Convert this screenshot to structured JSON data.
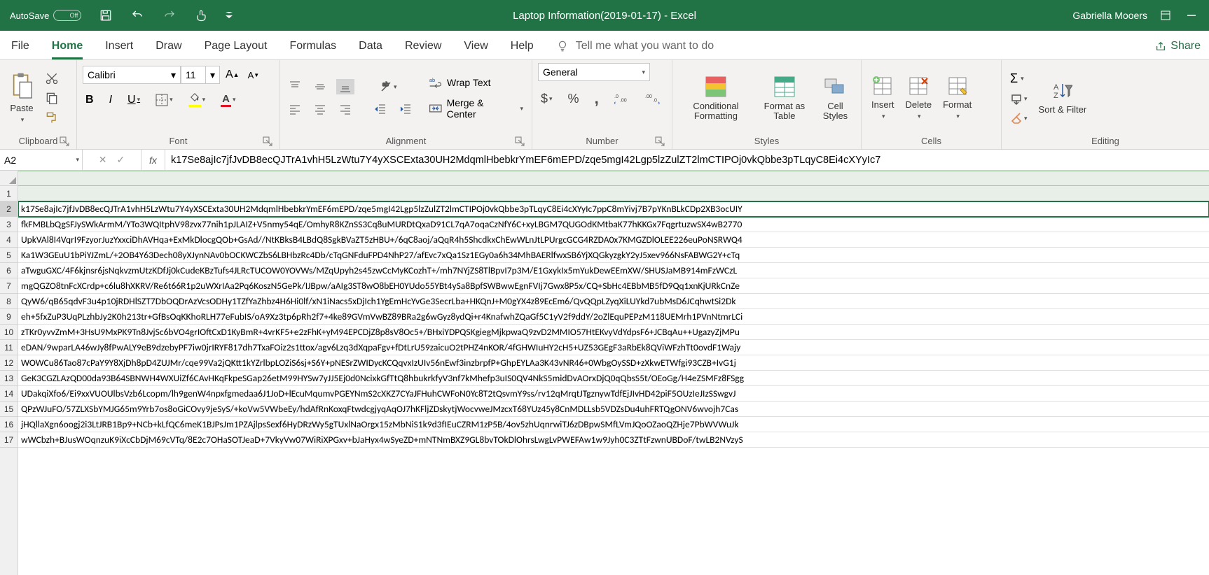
{
  "titlebar": {
    "autosave_label": "AutoSave",
    "autosave_state": "Off",
    "title": "Laptop Information(2019-01-17)  -  Excel",
    "user_name": "Gabriella Mooers"
  },
  "tabs": {
    "file": "File",
    "home": "Home",
    "insert": "Insert",
    "draw": "Draw",
    "page_layout": "Page Layout",
    "formulas": "Formulas",
    "data": "Data",
    "review": "Review",
    "view": "View",
    "help": "Help",
    "tell_me": "Tell me what you want to do",
    "share": "Share"
  },
  "ribbon": {
    "clipboard": {
      "label": "Clipboard",
      "paste": "Paste"
    },
    "font": {
      "label": "Font",
      "name": "Calibri",
      "size": "11",
      "bold": "B",
      "italic": "I",
      "underline": "U"
    },
    "alignment": {
      "label": "Alignment",
      "wrap": "Wrap Text",
      "merge": "Merge & Center"
    },
    "number": {
      "label": "Number",
      "format": "General"
    },
    "styles": {
      "label": "Styles",
      "conditional": "Conditional Formatting",
      "table": "Format as Table",
      "cell": "Cell Styles"
    },
    "cells": {
      "label": "Cells",
      "insert": "Insert",
      "delete": "Delete",
      "format": "Format"
    },
    "editing": {
      "label": "Editing",
      "sort": "Sort & Filter"
    }
  },
  "namebox": "A2",
  "fx_label": "fx",
  "formula_bar": "k17Se8ajIc7jfJvDB8ecQJTrA1vhH5LzWtu7Y4yXSCExta30UH2MdqmlHbebkrYmEF6mEPD/zqe5mgI42Lgp5lzZulZT2lmCTIPOj0vkQbbe3pTLqyC8Ei4cXYyIc7",
  "rows": [
    "",
    "k17Se8ajIc7jfJvDB8ecQJTrA1vhH5LzWtu7Y4yXSCExta30UH2MdqmlHbebkrYmEF6mEPD/zqe5mgI42Lgp5lzZulZT2lmCTIPOj0vkQbbe3pTLqyC8Ei4cXYyIc7ppC8mYivj7B7pYKnBLkCDp2XB3ocUIY",
    "fkFMBLbQgSFJySWkArmM/YTo3WQItphV98zvx77nih1pJLAIZ+V5nmy54qE/OmhyR8KZnSS3Cq8uMURDtQxaD91CL7qA7oqaCzNfY6C+xyLBGM7QUGOdKMtbaK77hKKGx7FqgrtuzwSX4wB2770",
    "UpkVAl8I4VqrI9FzyorJuzYxxciDhAVHqa+ExMkDlocgQOb+GsAd//NtKBksB4LBdQ8SgkBVaZT5zHBU+/6qC8aoj/aQqR4h5ShcdkxChEwWLnJtLPUrgcGCG4RZDA0x7KMGZDlOLEE226euPoNSRWQ4",
    "Ka1W3GEuU1bPiYJZmL/+2OB4Y63Dech08yXJynNAv0bOCKWCZbS6LBHbzRc4Db/cTqGNFduFPD4NhP27/afEvc7xQa1Sz1EGy0a6h34MhBAERlfwxSB6YjXQGkyzgkY2yJ5xev966NsFABWG2Y+cTq",
    "aTwguGXC/4F6kjnsr6jsNqkvzmUtzKDfJj0kCudeKBzTufs4JLRcTUCOW0YOVWs/MZqUpyh2s45zwCcMyKCozhT+/mh7NYjZS8TlBpvI7p3M/E1GxykIx5mYukDewEEmXW/SHUSJaMB914mFzWCzL",
    "mgQGZO8tnFcXCrdp+c6lu8hXKRV/Re6t66R1p2uWXrIAa2Pq6KoszN5GePk/IJBpw/aAIg3ST8wO8bEH0YUdo55YBt4ySa8BpfSWBwwEgnFVIj7Gwx8P5x/CQ+SbHc4EBbMB5fD9Qq1xnKjURkCnZe",
    "QyW6/qB65qdvF3u4p10jRDHlSZT7DbOQDrAzVcsODHy1TZfYaZhbz4H6Hi0lf/xN1iNacs5xDjIch1YgEmHcYvGe3SecrLba+HKQnJ+M0gYX4z89EcEm6/QvQQpLZyqXiLUYkd7ubMsD6JCqhwtSi2Dk",
    "eh+5fxZuP3UqPLzhbJy2K0h213tr+GfBsOqKKhoRLH77eFubIS/oA9Xz3tp6pRh2f7+4ke89GVmVwBZ89BRa2g6wGyz8ydQi+r4KnafwhZQaGf5C1yV2f9ddY/2oZlEquPEPzM118UEMrh1PVnNtmrLCi",
    "zTKr0yvvZmM+3HsU9MxPK9Tn8JvjSc6bVO4grIOftCxD1KyBmR+4vrKF5+e2zFhK+yM94EPCDjZ8p8sV8Oc5+/BHxiYDPQSKgiegMjkpwaQ9zvD2MMIO57HtEKvyVdYdpsF6+JCBqAu++UgazyZjMPu",
    "eDAN/9wparLA46wJy8fPwALY9eB9dzebyPF7iw0jrIRYF817dh7TxaFOiz2s1ttox/agv6Lzq3dXqpaFgv+fDtLrU59zaicuO2tPHZ4nKOR/4fGHWIuHY2cH5+UZ53GEgF3aRbEk8QViWFzhTt0ovdF1Wajy",
    "WOWCu86Tao87cPaY9Y8XjDh8pD4ZUJMr/cqe99Va2jQKtt1kYZrlbpLOZiS6sj+S6Y+pNESrZWIDycKCQqvxIzUIv56nEwf3inzbrpfP+GhpEYLAa3K43vNR46+0WbgOySSD+zXkwETWfgi93CZB+IvG1j",
    "GeK3CGZLAzQD00da93B64SBNWH4WXUiZf6CAvHKqFkpeSGap26etM99HYSw7yJJ5Ej0d0NcixkGfTtQ8hbukrkfyV3nf7kMhefp3uIS0QV4NkS5midDvAOrxDjQ0qQbsS5t/OEoGg/H4eZSMFz8FSgg",
    "UDakqiXfo6/Ei9xxVUOUlbsVzb6Lcopm/lh9genW4npxfgmedaa6J1JoD+lEcuMqumvPGEYNmS2cXKZ7CYaJFHuhCWFoN0Yc8T2tQsvmY9ss/rv12qMrqtJTgznywTdfEjJIvHD42piF5OUzIeJIzSSwgvJ",
    "QPzWJuFO/57ZLXSbYMJG65m9Yrb7os8oGiCOvy9jeSyS/+koVw5VWbeEy/hdAfRnKoxqFtwdcgjyqAqOJ7hKFljZDskytjWocvweJMzcxT68YUz45y8CnMDLLsb5VDZsDu4uhFRTQgONV6wvojh7Cas",
    "jHQllaXgn6oogj2i3LtJRB1Bp9+NCb+kLfQC6meK1BJPsJm1PZAjlpsSexf6HyDRzWy5gTUxlNaOrgx15zMbNiS1k9d3fIEuCZRM1zP5B/4ov5zhUqnrwiTJ6zDBpwSMfLVmJQoOZaoQZHje7PbWVWuJk",
    "wWCbzh+BJusWOqnzuK9iXcCbDjM69cVTq/8E2c7OHaSOTJeaD+7VkyVw07WiRiXPGxv+bJaHyx4wSyeZD+mNTNmBXZ9GL8bvTOkDlOhrsLwgLvPWEFAw1w9Jyh0C3ZTtFzwnUBDoF/twLB2NVzyS"
  ]
}
